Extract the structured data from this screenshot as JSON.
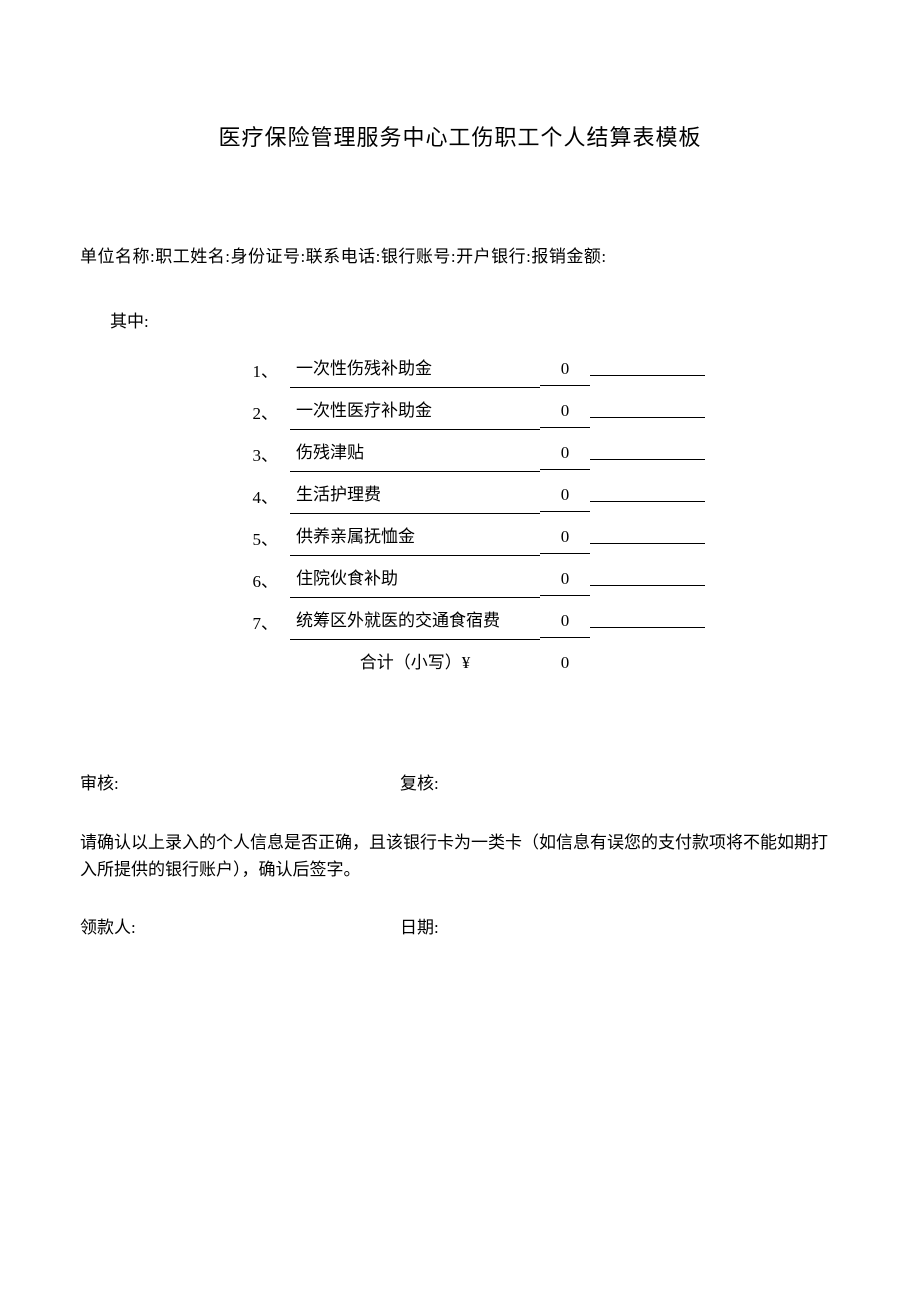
{
  "title": "医疗保险管理服务中心工伤职工个人结算表模板",
  "info_line": "单位名称:职工姓名:身份证号:联系电话:银行账号:开户银行:报销金额:",
  "among_label": "其中:",
  "rows": [
    {
      "num": "1、",
      "label": "一次性伤残补助金",
      "value": "0"
    },
    {
      "num": "2、",
      "label": "一次性医疗补助金",
      "value": "0"
    },
    {
      "num": "3、",
      "label": "伤残津贴",
      "value": "0"
    },
    {
      "num": "4、",
      "label": "生活护理费",
      "value": "0"
    },
    {
      "num": "5、",
      "label": "供养亲属抚恤金",
      "value": "0"
    },
    {
      "num": "6、",
      "label": "住院伙食补助",
      "value": "0"
    },
    {
      "num": "7、",
      "label": "统筹区外就医的交通食宿费",
      "value": "0"
    }
  ],
  "total_label": "合计（小写）¥",
  "total_value": "0",
  "audit_label": "审核:",
  "review_label": "复核:",
  "notice": "请确认以上录入的个人信息是否正确，且该银行卡为一类卡（如信息有误您的支付款项将不能如期打入所提供的银行账户），确认后签字。",
  "payee_label": "领款人:",
  "date_label": "日期:"
}
